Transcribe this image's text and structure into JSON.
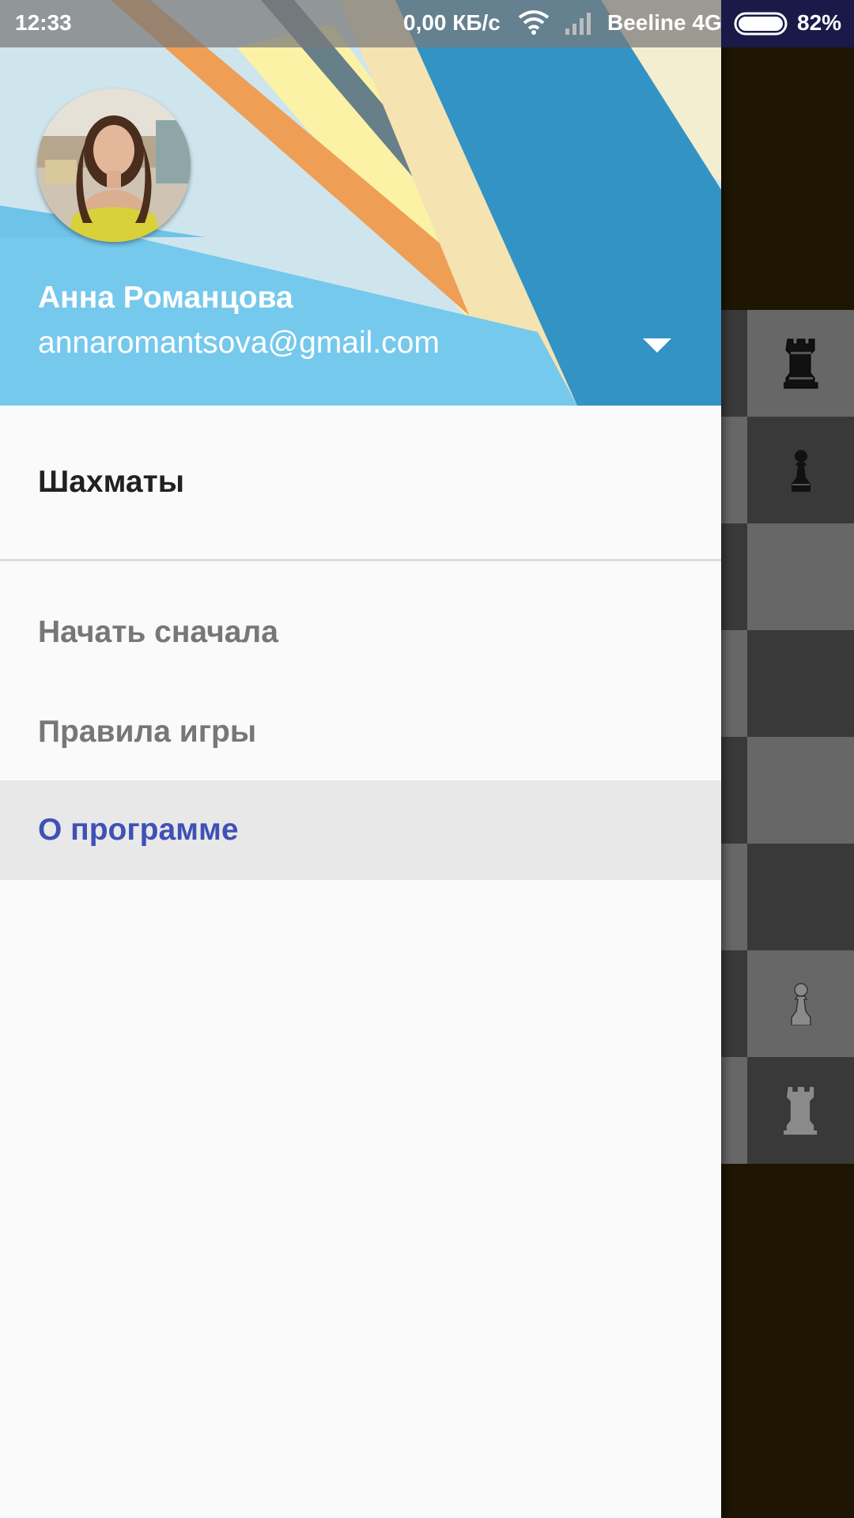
{
  "status_bar": {
    "time": "12:33",
    "net_speed": "0,00 КБ/с",
    "carrier": "Beeline 4G",
    "battery_percent": "82%",
    "battery_level": 0.82
  },
  "drawer": {
    "header": {
      "user_name": "Анна Романцова",
      "user_email": "annaromantsova@gmail.com"
    },
    "section_title": "Шахматы",
    "menu": [
      {
        "label": "Начать сначала",
        "selected": false
      },
      {
        "label": "Правила игры",
        "selected": false
      },
      {
        "label": "О программе",
        "selected": true
      }
    ],
    "selected_color": "#3f51b5"
  },
  "board": {
    "visible_pieces": [
      {
        "piece": "rook",
        "color": "black"
      },
      {
        "piece": "pawn",
        "color": "black"
      },
      {
        "piece": "pawn",
        "color": "white"
      },
      {
        "piece": "rook",
        "color": "white"
      }
    ]
  }
}
